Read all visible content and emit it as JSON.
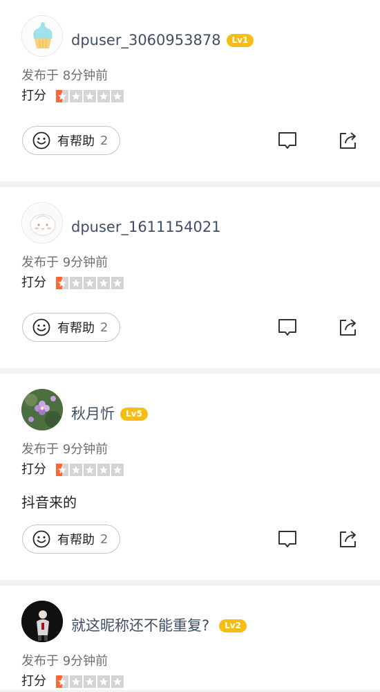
{
  "reviews": [
    {
      "username": "dpuser_3060953878",
      "level": "Lv1",
      "time": "发布于 8分钟前",
      "score_label": "打分",
      "rating_stars": 0.5,
      "content": "",
      "helpful_label": "有帮助",
      "helpful_count": "2",
      "avatar": "cupcake-avatar"
    },
    {
      "username": "dpuser_1611154021",
      "level": "",
      "time": "发布于 9分钟前",
      "score_label": "打分",
      "rating_stars": 0.5,
      "content": "",
      "helpful_label": "有帮助",
      "helpful_count": "2",
      "avatar": "bun-avatar"
    },
    {
      "username": "秋月忻",
      "level": "Lv5",
      "time": "发布于 9分钟前",
      "score_label": "打分",
      "rating_stars": 0.5,
      "content": "抖音来的",
      "helpful_label": "有帮助",
      "helpful_count": "2",
      "avatar": "flower-photo-avatar"
    },
    {
      "username": "就这昵称还不能重复?",
      "level": "Lv2",
      "time": "发布于 9分钟前",
      "score_label": "打分",
      "rating_stars": 0.5,
      "content": "",
      "avatar": "person-photo-avatar"
    }
  ],
  "colors": {
    "star_active": "#ff6633",
    "star_inactive": "#d4d4d4",
    "level_badge": "#f6bd16",
    "username": "#3d4f66"
  },
  "icons": [
    "smile-icon",
    "comment-icon",
    "share-icon",
    "star-icon"
  ]
}
